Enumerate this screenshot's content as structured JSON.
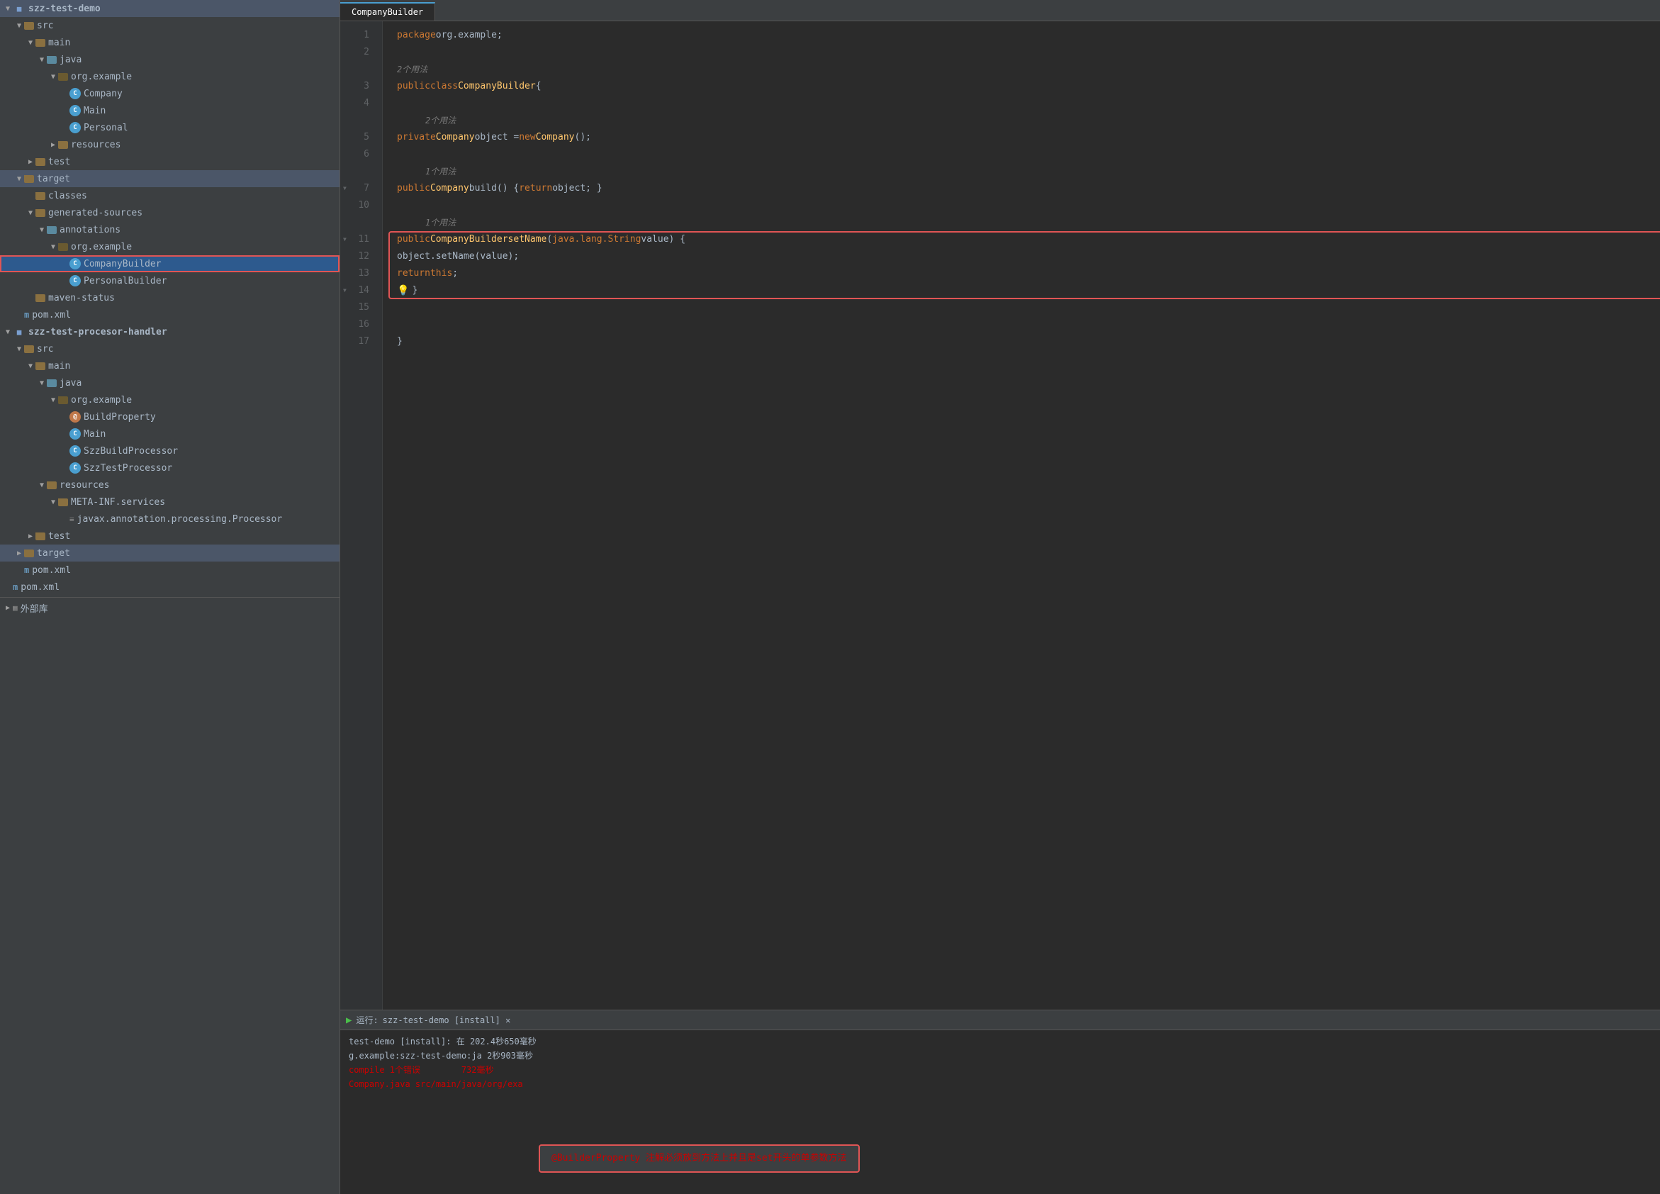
{
  "sidebar": {
    "projects": [
      {
        "id": "szz-test-demo",
        "label": "szz-test-demo",
        "type": "project",
        "expanded": true,
        "indent": 0,
        "children": [
          {
            "id": "src",
            "label": "src",
            "type": "folder-src",
            "indent": 1,
            "expanded": true
          },
          {
            "id": "main",
            "label": "main",
            "type": "folder",
            "indent": 2,
            "expanded": true
          },
          {
            "id": "java",
            "label": "java",
            "type": "folder-blue",
            "indent": 3,
            "expanded": true
          },
          {
            "id": "org.example",
            "label": "org.example",
            "type": "package",
            "indent": 4,
            "expanded": true
          },
          {
            "id": "Company",
            "label": "Company",
            "type": "class-c",
            "indent": 5
          },
          {
            "id": "Main",
            "label": "Main",
            "type": "class-c",
            "indent": 5
          },
          {
            "id": "Personal",
            "label": "Personal",
            "type": "class-c",
            "indent": 5
          },
          {
            "id": "resources",
            "label": "resources",
            "type": "folder",
            "indent": 4,
            "expanded": false
          },
          {
            "id": "test",
            "label": "test",
            "type": "folder",
            "indent": 2,
            "expanded": false
          },
          {
            "id": "target",
            "label": "target",
            "type": "folder-src",
            "indent": 1,
            "expanded": true
          },
          {
            "id": "classes",
            "label": "classes",
            "type": "folder",
            "indent": 2
          },
          {
            "id": "generated-sources",
            "label": "generated-sources",
            "type": "folder",
            "indent": 2,
            "expanded": true
          },
          {
            "id": "annotations",
            "label": "annotations",
            "type": "folder-g",
            "indent": 3,
            "expanded": true
          },
          {
            "id": "org.example2",
            "label": "org.example",
            "type": "package",
            "indent": 4,
            "expanded": true
          },
          {
            "id": "CompanyBuilder",
            "label": "CompanyBuilder",
            "type": "class-c",
            "indent": 5,
            "selected": true
          },
          {
            "id": "PersonalBuilder",
            "label": "PersonalBuilder",
            "type": "class-c",
            "indent": 5
          },
          {
            "id": "maven-status",
            "label": "maven-status",
            "type": "folder",
            "indent": 2
          },
          {
            "id": "pom.xml-demo",
            "label": "pom.xml",
            "type": "pom",
            "indent": 1
          }
        ]
      },
      {
        "id": "szz-test-procesor-handler",
        "label": "szz-test-procesor-handler",
        "type": "project",
        "expanded": true,
        "indent": 0,
        "children": [
          {
            "id": "src2",
            "label": "src",
            "type": "folder-src",
            "indent": 1,
            "expanded": true
          },
          {
            "id": "main2",
            "label": "main",
            "type": "folder",
            "indent": 2,
            "expanded": true
          },
          {
            "id": "java2",
            "label": "java",
            "type": "folder-blue",
            "indent": 3,
            "expanded": true
          },
          {
            "id": "org.example3",
            "label": "org.example",
            "type": "package",
            "indent": 4,
            "expanded": true
          },
          {
            "id": "BuildProperty",
            "label": "BuildProperty",
            "type": "class-a",
            "indent": 5
          },
          {
            "id": "Main2",
            "label": "Main",
            "type": "class-c",
            "indent": 5
          },
          {
            "id": "SzzBuildProcessor",
            "label": "SzzBuildProcessor",
            "type": "class-c",
            "indent": 5
          },
          {
            "id": "SzzTestProcessor",
            "label": "SzzTestProcessor",
            "type": "class-c",
            "indent": 5
          },
          {
            "id": "resources2",
            "label": "resources",
            "type": "folder",
            "indent": 3,
            "expanded": true
          },
          {
            "id": "META-INF.services",
            "label": "META-INF.services",
            "type": "folder",
            "indent": 4,
            "expanded": true
          },
          {
            "id": "javax.annotation.processing.Processor",
            "label": "javax.annotation.processing.Processor",
            "type": "file-plain",
            "indent": 5
          },
          {
            "id": "test2",
            "label": "test",
            "type": "folder",
            "indent": 2,
            "expanded": false
          },
          {
            "id": "target2",
            "label": "target",
            "type": "folder-src",
            "indent": 1,
            "expanded": false
          },
          {
            "id": "pom.xml-handler",
            "label": "pom.xml",
            "type": "pom",
            "indent": 1
          }
        ]
      },
      {
        "id": "pom.xml-root",
        "label": "pom.xml",
        "type": "pom",
        "indent": 0
      }
    ],
    "external_libs": "外部库"
  },
  "editor": {
    "tabs": [
      {
        "label": "CompanyBuilder",
        "active": true
      }
    ],
    "lines": [
      {
        "num": 1,
        "tokens": [
          {
            "t": "package ",
            "c": "kw"
          },
          {
            "t": "org.example",
            "c": "plain"
          },
          {
            "t": ";",
            "c": "plain"
          }
        ]
      },
      {
        "num": 2,
        "tokens": []
      },
      {
        "num": "2用法",
        "tokens": [
          {
            "t": "2个用法",
            "c": "hint"
          }
        ],
        "hint": true
      },
      {
        "num": 3,
        "tokens": [
          {
            "t": "public ",
            "c": "kw"
          },
          {
            "t": "class ",
            "c": "kw"
          },
          {
            "t": "CompanyBuilder",
            "c": "classname"
          },
          {
            "t": " {",
            "c": "plain"
          }
        ]
      },
      {
        "num": 4,
        "tokens": []
      },
      {
        "num": "2用法2",
        "tokens": [
          {
            "t": "    2个用法",
            "c": "hint"
          }
        ],
        "hint": true,
        "indent": true
      },
      {
        "num": 5,
        "tokens": [
          {
            "t": "    private ",
            "c": "kw"
          },
          {
            "t": "Company",
            "c": "classname"
          },
          {
            "t": " object = ",
            "c": "plain"
          },
          {
            "t": "new ",
            "c": "kw"
          },
          {
            "t": "Company",
            "c": "classname"
          },
          {
            "t": "();",
            "c": "plain"
          }
        ]
      },
      {
        "num": 6,
        "tokens": []
      },
      {
        "num": "1用法",
        "tokens": [
          {
            "t": "    1个用法",
            "c": "hint"
          }
        ],
        "hint": true,
        "indent": true
      },
      {
        "num": 7,
        "tokens": [
          {
            "t": "    public ",
            "c": "kw"
          },
          {
            "t": "Company",
            "c": "classname"
          },
          {
            "t": " build() { ",
            "c": "plain"
          },
          {
            "t": "return ",
            "c": "kw"
          },
          {
            "t": "object; }",
            "c": "plain"
          }
        ],
        "fold": true
      },
      {
        "num": 10,
        "tokens": []
      },
      {
        "num": "1用法2",
        "tokens": [
          {
            "t": "    1个用法",
            "c": "hint"
          }
        ],
        "hint": true,
        "indent": true
      },
      {
        "num": 11,
        "tokens": [
          {
            "t": "    public ",
            "c": "kw"
          },
          {
            "t": "CompanyBuilder",
            "c": "classname"
          },
          {
            "t": " setName(",
            "c": "plain"
          },
          {
            "t": "java.lang.String",
            "c": "type"
          },
          {
            "t": " value) {",
            "c": "plain"
          }
        ],
        "highlight_start": true
      },
      {
        "num": 12,
        "tokens": [
          {
            "t": "        object.setName(value);",
            "c": "plain"
          }
        ],
        "highlighted": true
      },
      {
        "num": 13,
        "tokens": [
          {
            "t": "        return ",
            "c": "kw"
          },
          {
            "t": "this",
            "c": "kw"
          },
          {
            "t": ";",
            "c": "plain"
          }
        ],
        "highlighted": true
      },
      {
        "num": 14,
        "tokens": [
          {
            "t": "    }",
            "c": "plain"
          }
        ],
        "highlight_end": true,
        "bulb": true
      },
      {
        "num": 15,
        "tokens": []
      },
      {
        "num": 16,
        "tokens": []
      },
      {
        "num": 17,
        "tokens": [
          {
            "t": "}",
            "c": "plain"
          }
        ]
      }
    ]
  },
  "bottom_panel": {
    "run_label": "运行:",
    "run_tab": "szz-test-demo [install]",
    "console_lines": [
      {
        "text": "test-demo [install]: 在 202.4秒650毫秒",
        "type": "normal"
      },
      {
        "text": "g.example:szz-test-demo:ja 2秒903毫秒",
        "type": "normal"
      },
      {
        "text": "compile  1个错误        732毫秒",
        "type": "error"
      },
      {
        "text": "Company.java src/main/java/org/exa",
        "type": "error"
      },
      {
        "text": "@BuildProperty 注解必须放到方法上并且是set开头的单参数方法",
        "type": "error-note"
      }
    ],
    "error_tooltip": "@BuilderProperty 注解必须放到方法上并且是set开头的单参数方法"
  }
}
